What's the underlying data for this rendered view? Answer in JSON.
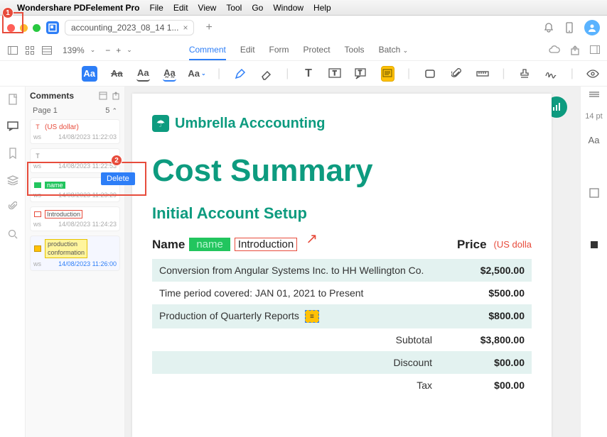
{
  "menubar": {
    "app": "Wondershare PDFelement Pro",
    "items": [
      "File",
      "Edit",
      "View",
      "Tool",
      "Go",
      "Window",
      "Help"
    ]
  },
  "tab": {
    "title": "accounting_2023_08_14 1..."
  },
  "zoom": "139%",
  "toolbar_tabs": {
    "comment": "Comment",
    "edit": "Edit",
    "form": "Form",
    "protect": "Protect",
    "tools": "Tools",
    "batch": "Batch"
  },
  "comments": {
    "header": "Comments",
    "page_label": "Page 1",
    "count": "5",
    "items": [
      {
        "text": "(US dollar)",
        "author": "ws",
        "time": "14/08/2023 11:22:03"
      },
      {
        "text": "",
        "author": "ws",
        "time": "14/08/2023 11:22:53"
      },
      {
        "text": "name",
        "author": "ws",
        "time": "14/08/2023 11:23:29"
      },
      {
        "text": "Introduction",
        "author": "ws",
        "time": "14/08/2023 11:24:23"
      },
      {
        "text1": "production",
        "text2": "conformation",
        "author": "ws",
        "time": "14/08/2023 11:26:00"
      }
    ]
  },
  "context_menu": {
    "delete": "Delete"
  },
  "font_size": "14 pt",
  "doc": {
    "logo": "Umbrella Acccounting",
    "title": "Cost Summary",
    "section": "Initial Account Setup",
    "name_label": "Name",
    "name_hl": "name",
    "intro": "Introduction",
    "price_label": "Price",
    "us": "(US dolla",
    "rows": [
      {
        "l": "Conversion from Angular Systems Inc. to HH Wellington Co.",
        "r": "$2,500.00"
      },
      {
        "l": "Time period covered: JAN 01, 2021 to Present",
        "r": "$500.00"
      },
      {
        "l": "Production of Quarterly Reports",
        "r": "$800.00"
      }
    ],
    "subtotal_l": "Subtotal",
    "subtotal_r": "$3,800.00",
    "discount_l": "Discount",
    "discount_r": "$00.00",
    "tax_l": "Tax",
    "tax_r": "$00.00"
  },
  "callouts": {
    "one": "1",
    "two": "2"
  }
}
